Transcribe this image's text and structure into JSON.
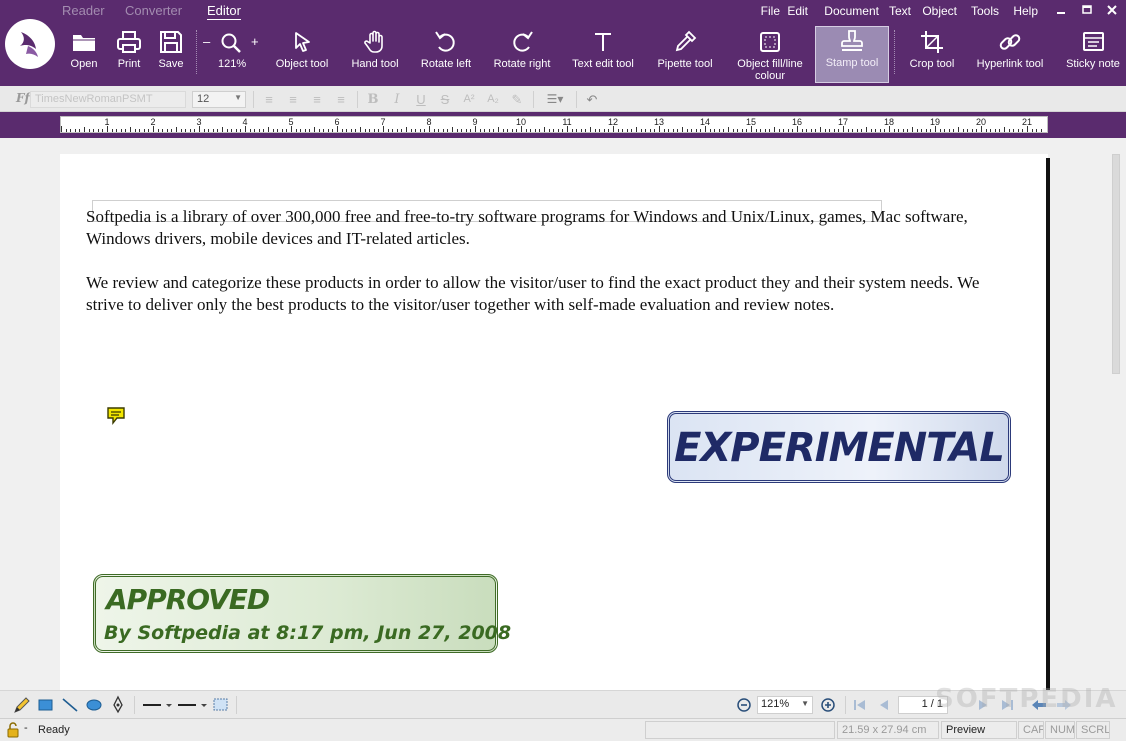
{
  "mode_tabs": [
    "Reader",
    "Converter",
    "Editor"
  ],
  "menu": [
    "File",
    "Edit",
    "Document",
    "Text",
    "Object",
    "Tools",
    "Help"
  ],
  "toolbar": {
    "open": "Open",
    "print": "Print",
    "save": "Save",
    "zoom_minus": "–",
    "zoom_plus": "+",
    "zoom": "121%",
    "object_tool": "Object tool",
    "hand_tool": "Hand tool",
    "rotate_left": "Rotate left",
    "rotate_right": "Rotate right",
    "text_edit_tool": "Text edit tool",
    "pipette_tool": "Pipette tool",
    "object_fill_1": "Object fill/line",
    "object_fill_2": "colour",
    "stamp_tool": "Stamp tool",
    "crop_tool": "Crop tool",
    "hyperlink_tool": "Hyperlink tool",
    "sticky_note": "Sticky note"
  },
  "format": {
    "font_name": "TimesNewRomanPSMT",
    "font_size": "12"
  },
  "ruler": {
    "numbers": [
      "1",
      "2",
      "3",
      "4",
      "5",
      "6",
      "7",
      "8",
      "9",
      "10",
      "11",
      "12",
      "13",
      "14",
      "15",
      "16",
      "17",
      "18",
      "19",
      "20",
      "21"
    ]
  },
  "document": {
    "para1": "Softpedia is a library of over 300,000 free and free-to-try software programs for Windows and Unix/Linux, games, Mac software, Windows drivers, mobile devices and IT-related articles.",
    "para2": "We review and categorize these products in order to allow the visitor/user to find the exact product they and their system needs. We strive to deliver only the best products to the visitor/user together with self-made evaluation and review notes.",
    "stamp_experimental": "EXPERIMENTAL",
    "stamp_approved_title": "APPROVED",
    "stamp_approved_sub": "By Softpedia at 8:17 pm, Jun 27, 2008"
  },
  "bottom": {
    "zoom": "121%",
    "page": "1 / 1"
  },
  "status": {
    "lock_dash": "-",
    "ready": "Ready",
    "dimensions": "21.59 x 27.94 cm",
    "preview": "Preview",
    "cap": "CAP",
    "num": "NUM",
    "scrl": "SCRL"
  },
  "watermark": "SOFTPEDIA",
  "colors": {
    "ribbon": "#5a2b6e",
    "stamp_experimental": "#1f2a66",
    "stamp_approved": "#3a6a22"
  }
}
